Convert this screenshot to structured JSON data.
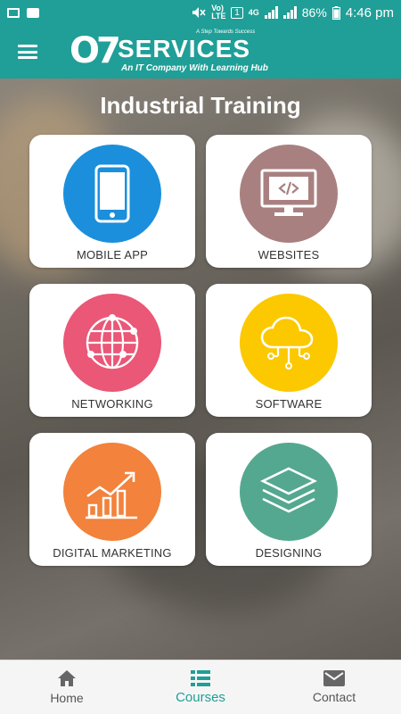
{
  "status_bar": {
    "lte_label": "Vo) LTE",
    "sim": "1",
    "network": "4G",
    "battery": "86%",
    "time": "4:46 pm"
  },
  "app_bar": {
    "logo_mark": "O7",
    "logo_name": "SERVICES",
    "logo_tagline": "A Step Towards Success",
    "logo_subtitle": "An IT Company With Learning Hub"
  },
  "page": {
    "title": "Industrial Training"
  },
  "courses": [
    {
      "label": "MOBILE APP",
      "icon": "mobile-phone-icon",
      "color": "#1b8fdc"
    },
    {
      "label": "WEBSITES",
      "icon": "code-monitor-icon",
      "color": "#a98080"
    },
    {
      "label": "NETWORKING",
      "icon": "globe-icon",
      "color": "#ea5777"
    },
    {
      "label": "SOFTWARE",
      "icon": "cloud-icon",
      "color": "#fcc800"
    },
    {
      "label": "DIGITAL MARKETING",
      "icon": "growth-chart-icon",
      "color": "#f2823c"
    },
    {
      "label": "DESIGNING",
      "icon": "layers-icon",
      "color": "#54a88f"
    }
  ],
  "bottom_nav": {
    "items": [
      {
        "label": "Home",
        "icon": "home-icon",
        "active": false
      },
      {
        "label": "Courses",
        "icon": "list-icon",
        "active": true
      },
      {
        "label": "Contact",
        "icon": "mail-icon",
        "active": false
      }
    ],
    "active_color": "#1f9f97"
  },
  "colors": {
    "primary": "#1f9f97"
  }
}
